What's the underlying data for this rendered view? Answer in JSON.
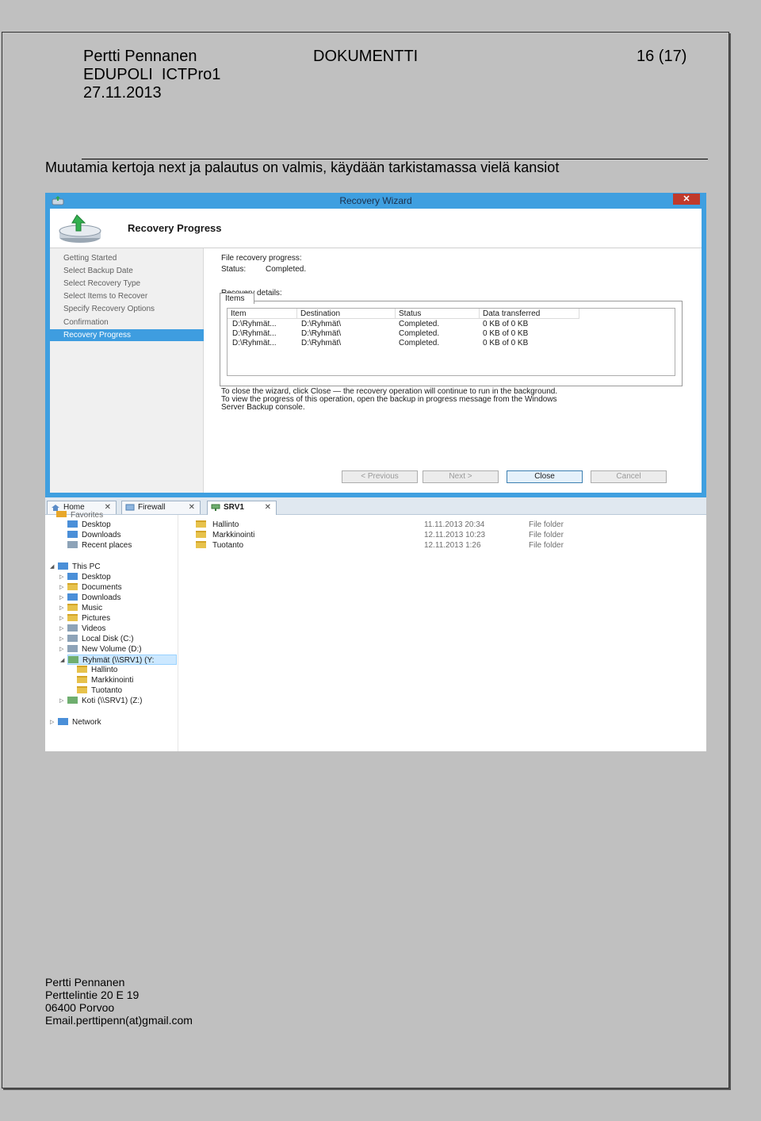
{
  "header": {
    "author": "Pertti Pennanen",
    "org": "EDUPOLI  ICTPro1",
    "date": "27.11.2013",
    "doc_type": "DOKUMENTTI",
    "page": "16 (17)"
  },
  "caption": "Muutamia kertoja next ja palautus on valmis, käydään tarkistamassa vielä kansiot",
  "wizard": {
    "title": "Recovery Wizard",
    "close": "✕",
    "heading": "Recovery Progress",
    "nav": [
      "Getting Started",
      "Select Backup Date",
      "Select Recovery Type",
      "Select Items to Recover",
      "Specify Recovery Options",
      "Confirmation",
      "Recovery Progress"
    ],
    "progress_label": "File recovery progress:",
    "status_label": "Status:",
    "status_value": "Completed.",
    "details_label": "Recovery details:",
    "tab": "Items",
    "columns": [
      "Item",
      "Destination",
      "Status",
      "Data transferred"
    ],
    "rows": [
      [
        "D:\\Ryhmät...",
        "D:\\Ryhmät\\",
        "Completed.",
        "0 KB of 0 KB"
      ],
      [
        "D:\\Ryhmät...",
        "D:\\Ryhmät\\",
        "Completed.",
        "0 KB of 0 KB"
      ],
      [
        "D:\\Ryhmät...",
        "D:\\Ryhmät\\",
        "Completed.",
        "0 KB of 0 KB"
      ]
    ],
    "note1": "To close the wizard, click Close — the recovery operation will continue to run in the background.",
    "note2": "To view the progress of this operation, open the backup in progress message from the Windows",
    "note3": "Server Backup console.",
    "btn_prev": "< Previous",
    "btn_next": "Next >",
    "btn_close": "Close",
    "btn_cancel": "Cancel"
  },
  "explorer": {
    "tabs": [
      "Home",
      "Firewall",
      "SRV1"
    ],
    "tab_close": "✕",
    "tree": {
      "favorites": "Favorites",
      "fav_items": [
        "Desktop",
        "Downloads",
        "Recent places"
      ],
      "this_pc": "This PC",
      "pc_items": [
        "Desktop",
        "Documents",
        "Downloads",
        "Music",
        "Pictures",
        "Videos",
        "Local Disk (C:)",
        "New Volume (D:)",
        "Ryhmät (\\\\SRV1) (Y:"
      ],
      "sub_items": [
        "Hallinto",
        "Markkinointi",
        "Tuotanto"
      ],
      "koti": "Koti (\\\\SRV1) (Z:)",
      "network": "Network"
    },
    "files": [
      {
        "name": "Hallinto",
        "date": "11.11.2013 20:34",
        "type": "File folder"
      },
      {
        "name": "Markkinointi",
        "date": "12.11.2013 10:23",
        "type": "File folder"
      },
      {
        "name": "Tuotanto",
        "date": "12.11.2013 1:26",
        "type": "File folder"
      }
    ]
  },
  "footer": {
    "name": "Pertti Pennanen",
    "street": "Perttelintie 20 E 19",
    "city": "06400 Porvoo",
    "email": "Email.perttipenn(at)gmail.com"
  }
}
